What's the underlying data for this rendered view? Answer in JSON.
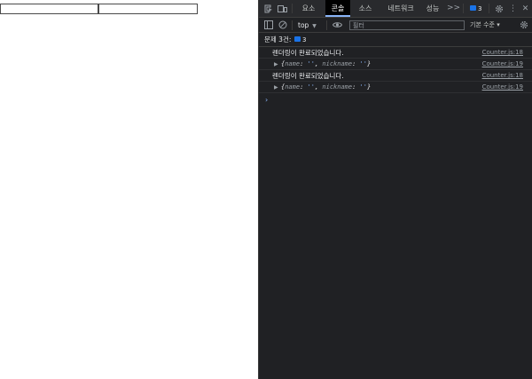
{
  "page": {
    "inputs": [
      {
        "name": "name",
        "value": ""
      },
      {
        "name": "nickname",
        "value": ""
      }
    ]
  },
  "devtools": {
    "tabs": [
      {
        "label": "요소",
        "active": false
      },
      {
        "label": "콘솔",
        "active": true
      },
      {
        "label": "소스",
        "active": false
      },
      {
        "label": "네트워크",
        "active": false
      },
      {
        "label": "성능",
        "active": false
      }
    ],
    "more_tabs": ">>",
    "issues_chip_count": "3",
    "toolbar": {
      "context": "top",
      "filter_placeholder": "필터",
      "levels": "기본 수준 ▾"
    },
    "issues_bar": {
      "label": "문제 3건:",
      "count": "3"
    },
    "console": {
      "messages": [
        {
          "type": "log",
          "text": "렌더링이 완료되었습니다.",
          "source": "Counter.js:18"
        },
        {
          "type": "object",
          "name": "''",
          "nickname": "''",
          "source": "Counter.js:19"
        },
        {
          "type": "log",
          "text": "렌더링이 완료되었습니다.",
          "source": "Counter.js:18"
        },
        {
          "type": "object",
          "name": "''",
          "nickname": "''",
          "source": "Counter.js:19"
        }
      ],
      "prompt": "›"
    },
    "colors": {
      "panel_bg": "#202124",
      "tabbar_bg": "#292a2d",
      "active_tab_bg": "#000000",
      "accent": "#8ab4f8",
      "badge": "#1a73e8"
    }
  }
}
